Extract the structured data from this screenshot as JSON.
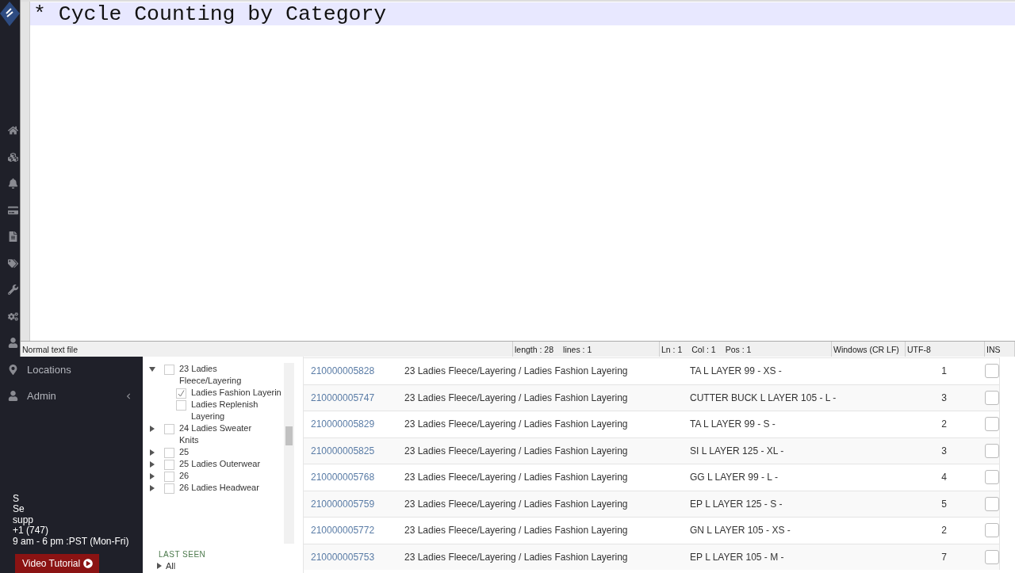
{
  "editor": {
    "lines": [
      {
        "text": "* Cycle Counting by Category",
        "current": true
      }
    ],
    "status_bar": [
      {
        "texts": [
          "Normal text file"
        ]
      },
      {
        "texts": [
          "length : 28",
          "lines : 1"
        ]
      },
      {
        "texts": [
          "Ln : 1",
          "Col : 1",
          "Pos : 1"
        ]
      },
      {
        "texts": [
          "Windows (CR LF)"
        ]
      },
      {
        "texts": [
          "UTF-8"
        ]
      },
      {
        "texts": [
          "INS"
        ]
      }
    ]
  },
  "sidebar": {
    "nav": [
      {
        "label": "Locations",
        "expandable": false
      },
      {
        "label": "Admin",
        "expandable": true
      }
    ],
    "support_lines": [
      "S",
      "Se",
      "supp",
      "+1 (747)",
      "9 am - 6 pm :PST (Mon-Fri)"
    ],
    "video_button": "Video Tutorial"
  },
  "categories": {
    "tree": [
      {
        "label": "23 Ladies Fleece/Layering",
        "expanded": true,
        "checked": false,
        "children": [
          {
            "label": "Ladies Fashion Layerin",
            "checked": true
          },
          {
            "label": "Ladies Replenish Layering",
            "checked": false
          }
        ]
      },
      {
        "label": "24 Ladies Sweater Knits",
        "expanded": false,
        "checked": false
      },
      {
        "label": "25",
        "expanded": false,
        "checked": false
      },
      {
        "label": "25 Ladies Outerwear",
        "expanded": false,
        "checked": false
      },
      {
        "label": "26",
        "expanded": false,
        "checked": false
      },
      {
        "label": "26 Ladies Headwear",
        "expanded": false,
        "checked": false
      }
    ],
    "last_seen": {
      "title": "LAST SEEN",
      "items": [
        {
          "label": "All",
          "expanded": false
        }
      ]
    }
  },
  "table": {
    "rows": [
      {
        "id": "210000005828",
        "category": "23 Ladies Fleece/Layering / Ladies Fashion Layering",
        "description": "TA L LAYER 99 - XS -",
        "qty": "1",
        "checked": false
      },
      {
        "id": "210000005747",
        "category": "23 Ladies Fleece/Layering / Ladies Fashion Layering",
        "description": "CUTTER BUCK L LAYER 105 - L -",
        "qty": "3",
        "checked": false
      },
      {
        "id": "210000005829",
        "category": "23 Ladies Fleece/Layering / Ladies Fashion Layering",
        "description": "TA L LAYER 99 - S -",
        "qty": "2",
        "checked": false
      },
      {
        "id": "210000005825",
        "category": "23 Ladies Fleece/Layering / Ladies Fashion Layering",
        "description": "SI L LAYER 125 - XL -",
        "qty": "3",
        "checked": false
      },
      {
        "id": "210000005768",
        "category": "23 Ladies Fleece/Layering / Ladies Fashion Layering",
        "description": "GG L LAYER 99 - L -",
        "qty": "4",
        "checked": false
      },
      {
        "id": "210000005759",
        "category": "23 Ladies Fleece/Layering / Ladies Fashion Layering",
        "description": "EP L LAYER 125 - S -",
        "qty": "5",
        "checked": false
      },
      {
        "id": "210000005772",
        "category": "23 Ladies Fleece/Layering / Ladies Fashion Layering",
        "description": "GN L LAYER 105 - XS -",
        "qty": "2",
        "checked": false
      },
      {
        "id": "210000005753",
        "category": "23 Ladies Fleece/Layering / Ladies Fashion Layering",
        "description": "EP L LAYER 105 - M -",
        "qty": "7",
        "checked": false
      }
    ]
  }
}
